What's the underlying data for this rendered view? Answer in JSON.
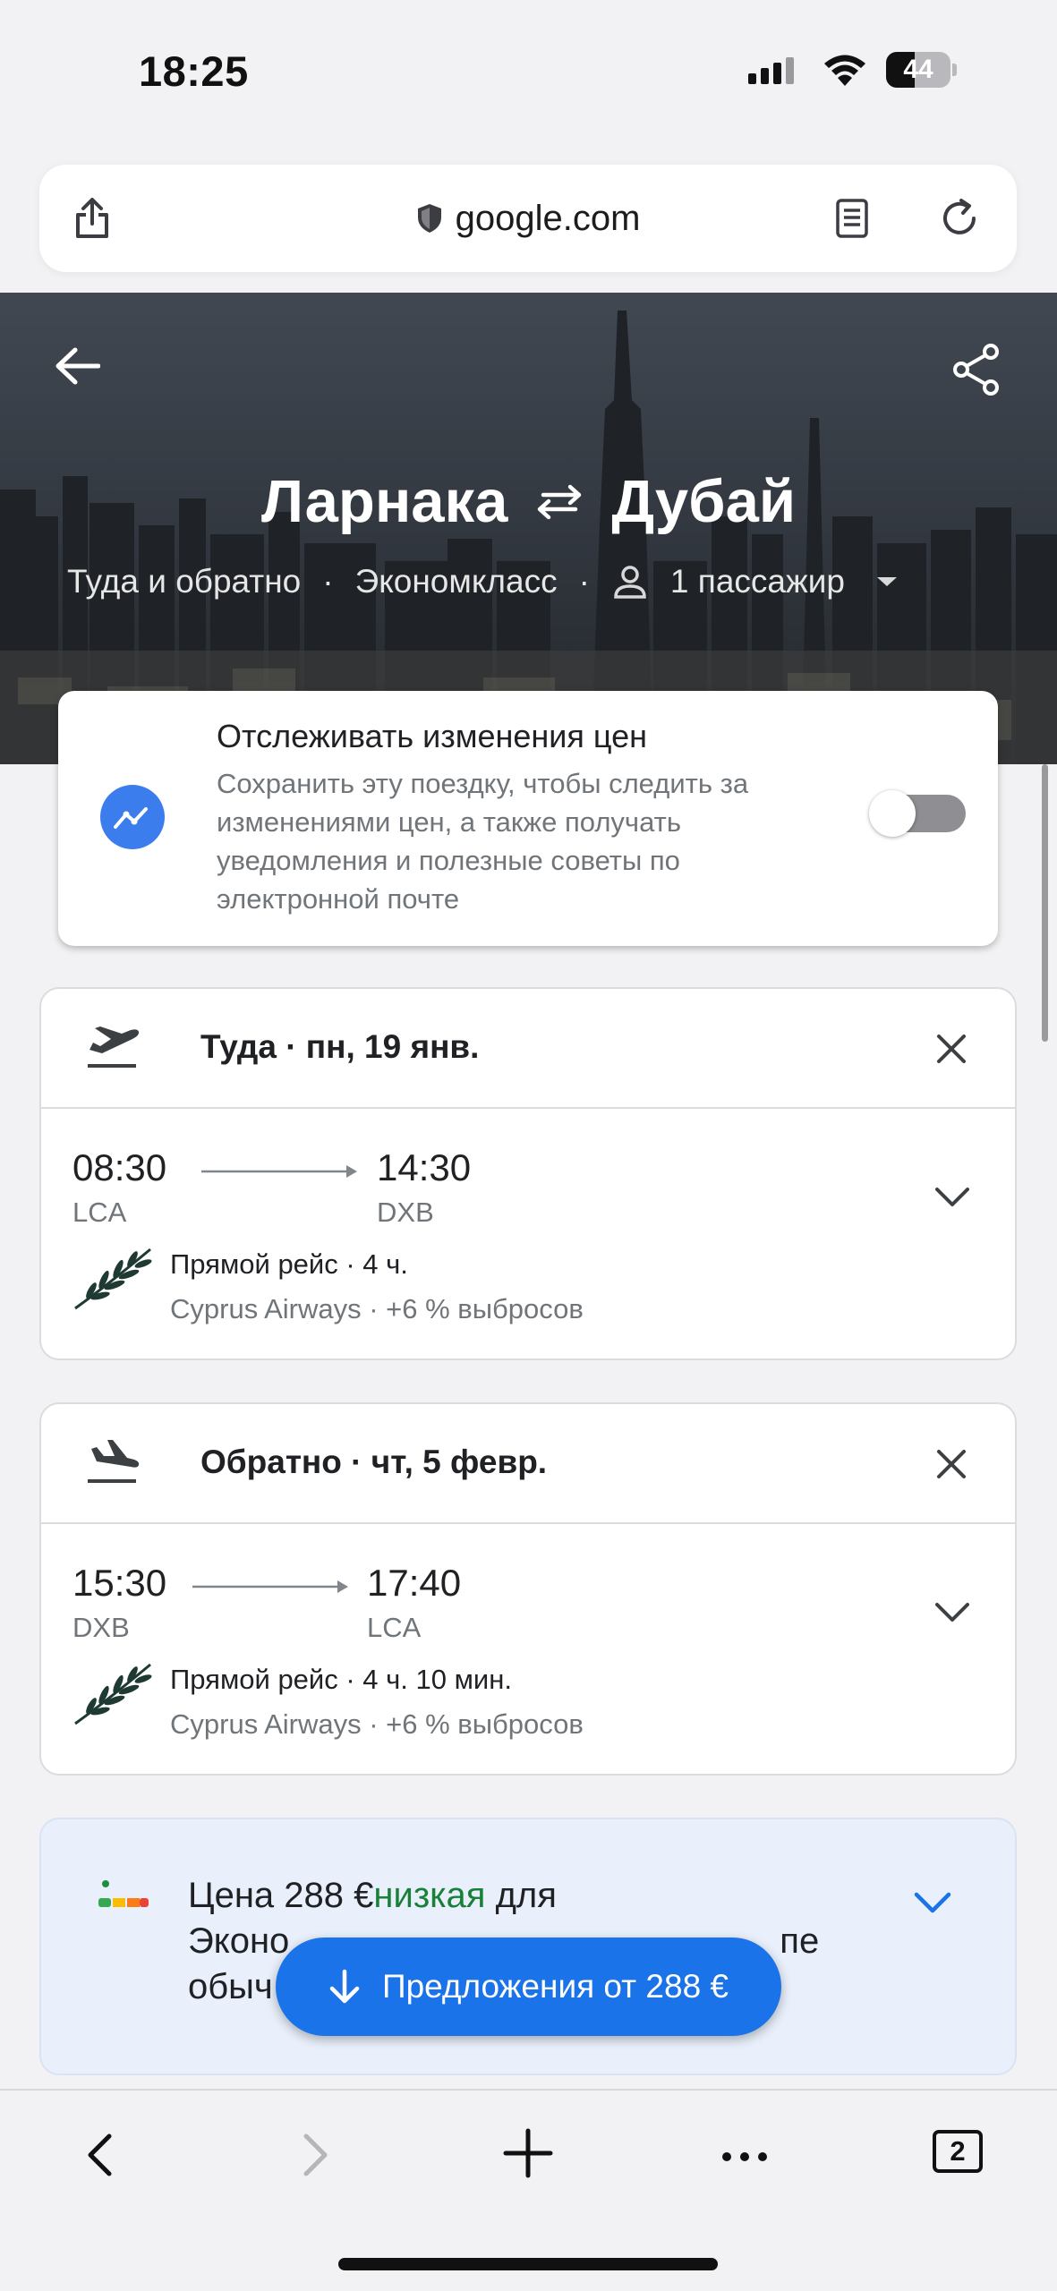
{
  "status_bar": {
    "time": "18:25",
    "battery": "44",
    "battery_level": 0.44
  },
  "browser": {
    "url": "google.com"
  },
  "hero": {
    "from": "Ларнака",
    "to": "Дубай",
    "trip_type": "Туда и обратно",
    "cabin": "Экономкласс",
    "passengers": "1 пассажир",
    "separator": "·"
  },
  "track_prices": {
    "title": "Отслеживать изменения цен",
    "description": "Сохранить эту поездку, чтобы следить за изменениями цен, а также получать уведомления и полезные советы по электронной почте",
    "enabled": false
  },
  "outbound": {
    "header": "Туда · пн, 19 янв.",
    "dep_time": "08:30",
    "dep_code": "LCA",
    "arr_time": "14:30",
    "arr_code": "DXB",
    "route": "Прямой рейс · 4 ч.",
    "airline": "Cyprus Airways · +6 % выбросов"
  },
  "return": {
    "header": "Обратно · чт, 5 февр.",
    "dep_time": "15:30",
    "dep_code": "DXB",
    "arr_time": "17:40",
    "arr_code": "LCA",
    "route": "Прямой рейс · 4 ч. 10 мин.",
    "airline": "Cyprus Airways · +6 % выбросов"
  },
  "price_insight": {
    "prefix": "Цена 288 €",
    "level": "низкая",
    "suffix_line1": " для",
    "line2": "Эконо",
    "line2_tail": "пе",
    "line3": "обыч",
    "colors": {
      "low": "#188038"
    }
  },
  "fab": {
    "label": "Предложения от 288 €"
  },
  "toolbar": {
    "tabs_count": "2"
  },
  "colors": {
    "accent": "#1a73e8",
    "track_icon": "#3b7ded"
  }
}
